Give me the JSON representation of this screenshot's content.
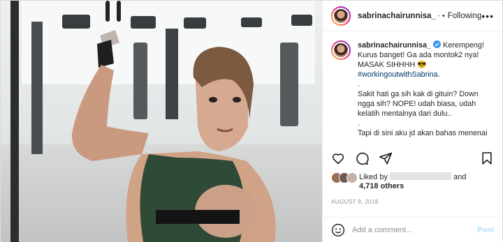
{
  "post": {
    "username": "sabrinachairunnisa_",
    "follow_status": "Following",
    "more_glyph": "•••",
    "caption": {
      "username": "sabrinachairunnisa_",
      "text": "Kerempeng! Kurus banget! Ga ada montok2 nya! MASAK SIHHHH 😎",
      "hashtag": "#workingoutwithSabrina",
      "hashtag_suffix": ".",
      "body": ".\nSakit hati ga sih kak di gituin? Down ngga sih? NOPE! udah biasa, udah kelatih mentalnya dari dulu..\n.\nTapi di sini aku jd akan bahas menenai"
    },
    "likes": {
      "liked_by": "Liked by",
      "and": "and",
      "others": "4,718 others"
    },
    "date": "AUGUST 9, 2018",
    "comment_placeholder": "Add a comment...",
    "post_button": "Post"
  },
  "icons": {
    "heart": "heart-icon",
    "comment": "comment-icon",
    "share": "share-icon",
    "save": "bookmark-icon",
    "emoji": "emoji-icon",
    "verified": "verified-badge-icon"
  },
  "colors": {
    "verified": "#3897f0",
    "hashtag": "#00376b",
    "post_disabled": "#b2dffc",
    "date": "#8e8e8e"
  }
}
